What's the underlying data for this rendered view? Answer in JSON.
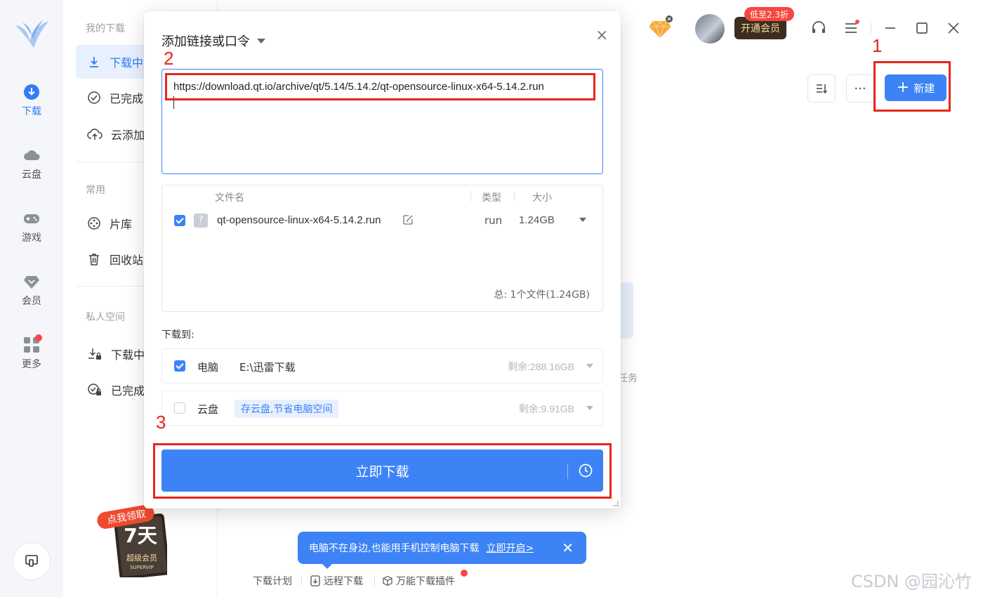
{
  "rail": {
    "items": [
      {
        "label": "下载",
        "icon": "download-icon"
      },
      {
        "label": "云盘",
        "icon": "cloud-icon"
      },
      {
        "label": "游戏",
        "icon": "gamepad-icon"
      },
      {
        "label": "会员",
        "icon": "diamond-icon"
      },
      {
        "label": "更多",
        "icon": "grid-icon"
      }
    ]
  },
  "sidebar": {
    "my_downloads": "我的下载",
    "downloading": "下载中",
    "completed": "已完成",
    "cloud_add": "云添加",
    "common": "常用",
    "library": "片库",
    "recycle": "回收站",
    "private_space": "私人空间",
    "private_downloading": "下载中",
    "private_completed": "已完成"
  },
  "promo": {
    "line1": "点我领取",
    "days": "7天",
    "line2": "超级会员",
    "line3": "SUPERVIP"
  },
  "topbar": {
    "vip_tag": "低至2.3折",
    "vip_button": "开通会员",
    "new_button": "新建",
    "more_button": "···"
  },
  "empty_state": {
    "text": "任务"
  },
  "annotations": {
    "n1": "1",
    "n2": "2",
    "n3": "3"
  },
  "dialog": {
    "title": "添加链接或口令",
    "close": "×",
    "url": "https://download.qt.io/archive/qt/5.14/5.14.2/qt-opensource-linux-x64-5.14.2.run",
    "file_table": {
      "col_name": "文件名",
      "col_type": "类型",
      "col_size": "大小",
      "file_name": "qt-opensource-linux-x64-5.14.2.run",
      "file_type": "run",
      "file_size": "1.24GB",
      "total": "总:   1个文件(1.24GB)"
    },
    "save_to": "下载到:",
    "dest_pc": {
      "name": "电脑",
      "path": "E:\\迅雷下载",
      "remain": "剩余:288.16GB"
    },
    "dest_cloud": {
      "name": "云盘",
      "hint": "存云盘,节省电脑空间",
      "remain": "剩余:9.91GB"
    },
    "download_button": "立即下载"
  },
  "bottom": {
    "plan": "下载计划",
    "remote": "远程下载",
    "plugin": "万能下载插件",
    "tip": "电脑不在身边,也能用手机控制电脑下载",
    "tip_link": "立即开启>",
    "tip_close": "✕"
  },
  "watermark": "CSDN @园沁竹",
  "colors": {
    "accent": "#3d83f6",
    "annotation": "#e8251c",
    "vip_dark": "#3c2e1f"
  }
}
